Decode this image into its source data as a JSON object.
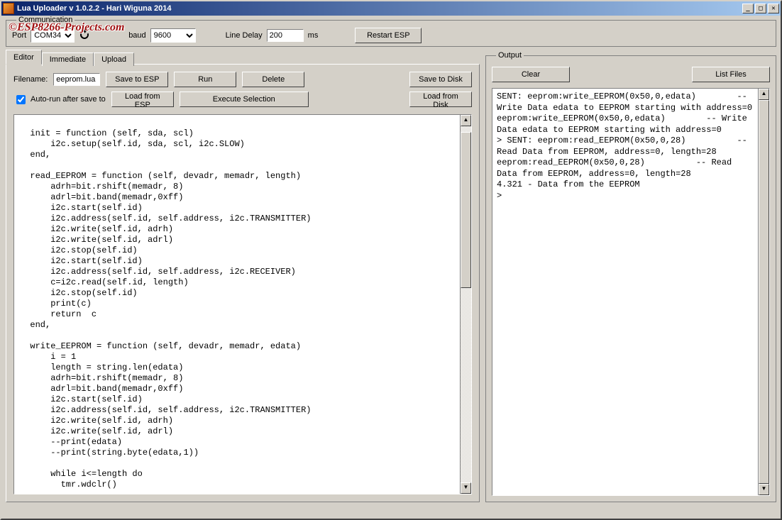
{
  "window": {
    "title": "Lua Uploader v 1.0.2.2 - Hari Wiguna 2014"
  },
  "watermark": "©ESP8266-Projects.com",
  "comm": {
    "legend": "Communication",
    "port_label": "Port",
    "port_value": "COM34",
    "baud_label": "baud",
    "baud_value": "9600",
    "line_delay_label": "Line Delay",
    "line_delay_value": "200",
    "line_delay_unit": "ms",
    "restart_label": "Restart ESP"
  },
  "tabs": {
    "editor": "Editor",
    "immediate": "Immediate",
    "upload": "Upload"
  },
  "editor": {
    "filename_label": "Filename:",
    "filename_value": "eeprom.lua",
    "save_to_esp": "Save to ESP",
    "run": "Run",
    "delete": "Delete",
    "save_to_disk": "Save to Disk",
    "autorun_label": "Auto-run after save to",
    "autorun_checked": true,
    "load_from_esp": "Load from ESP",
    "execute_selection": "Execute Selection",
    "load_from_disk": "Load from Disk",
    "code": "\n  init = function (self, sda, scl)\n      i2c.setup(self.id, sda, scl, i2c.SLOW)\n  end,\n\n  read_EEPROM = function (self, devadr, memadr, length)\n      adrh=bit.rshift(memadr, 8)\n      adrl=bit.band(memadr,0xff)\n      i2c.start(self.id)\n      i2c.address(self.id, self.address, i2c.TRANSMITTER)\n      i2c.write(self.id, adrh)\n      i2c.write(self.id, adrl)\n      i2c.stop(self.id)\n      i2c.start(self.id)\n      i2c.address(self.id, self.address, i2c.RECEIVER)\n      c=i2c.read(self.id, length)\n      i2c.stop(self.id)\n      print(c)\n      return  c\n  end,\n\n  write_EEPROM = function (self, devadr, memadr, edata)\n      i = 1\n      length = string.len(edata)\n      adrh=bit.rshift(memadr, 8)\n      adrl=bit.band(memadr,0xff)\n      i2c.start(self.id)\n      i2c.address(self.id, self.address, i2c.TRANSMITTER)\n      i2c.write(self.id, adrh)\n      i2c.write(self.id, adrl)\n      --print(edata)\n      --print(string.byte(edata,1))\n\n      while i<=length do\n        tmr.wdclr()"
  },
  "output": {
    "legend": "Output",
    "clear": "Clear",
    "list_files": "List Files",
    "text": "SENT: eeprom:write_EEPROM(0x50,0,edata)        -- Write Data edata to EEPROM starting with address=0\neeprom:write_EEPROM(0x50,0,edata)        -- Write Data edata to EEPROM starting with address=0\n> SENT: eeprom:read_EEPROM(0x50,0,28)          -- Read Data from EEPROM, address=0, length=28\neeprom:read_EEPROM(0x50,0,28)          -- Read Data from EEPROM, address=0, length=28\n4.321 - Data from the EEPROM\n> "
  }
}
